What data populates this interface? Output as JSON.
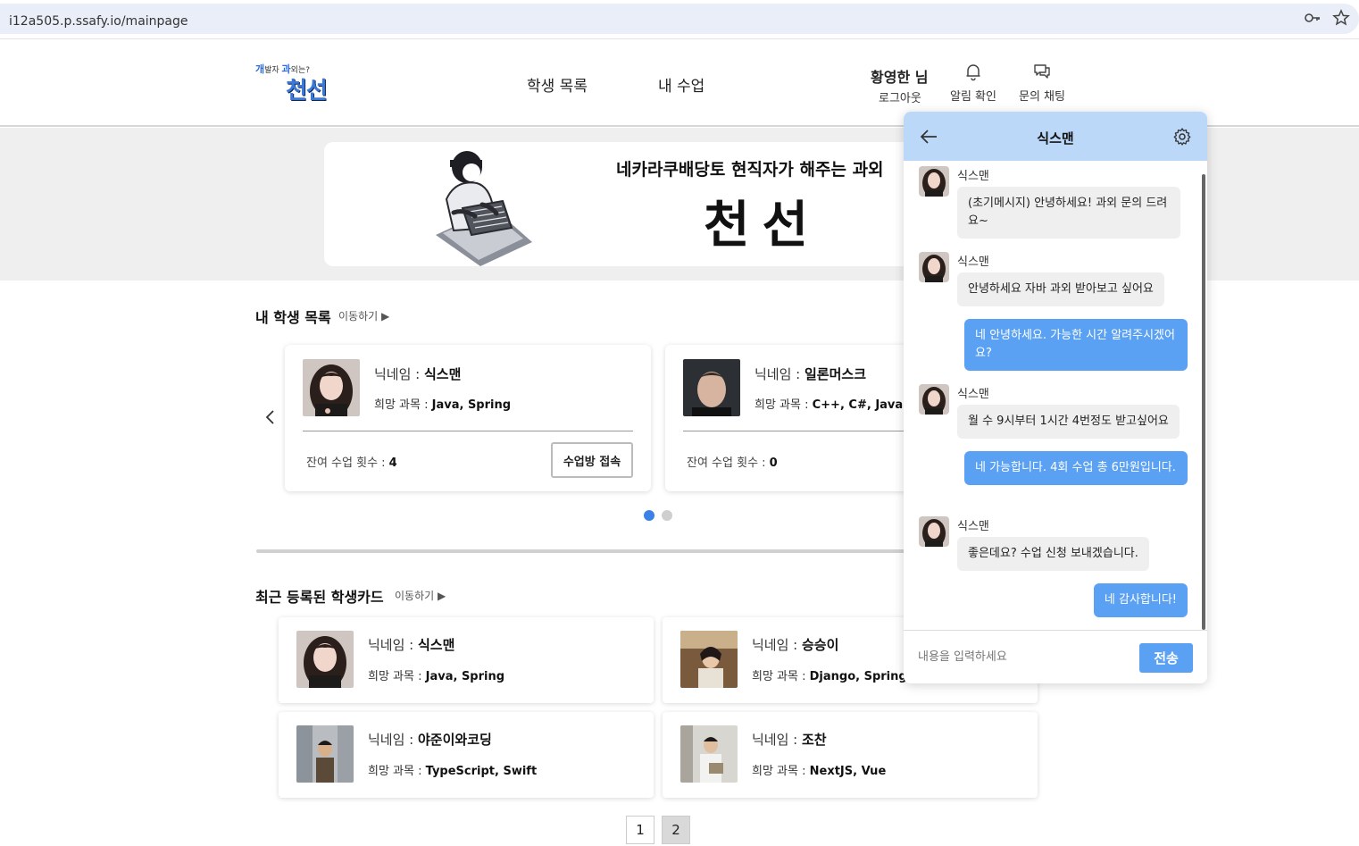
{
  "browser": {
    "url": "i12a505.p.ssafy.io/mainpage"
  },
  "header": {
    "logo_small_a": "개",
    "logo_small_b": "발자 ",
    "logo_small_c": "과",
    "logo_small_d": "외는?",
    "logo_main": "천선",
    "nav": [
      "학생 목록",
      "내 수업"
    ],
    "user_name": "황영한 님",
    "logout": "로그아웃",
    "notify_label": "알림 확인",
    "chat_label": "문의 채팅"
  },
  "banner": {
    "subtitle": "네카라쿠배당토 현직자가 해주는 과외",
    "title": "천선"
  },
  "my_students": {
    "title": "내 학생 목록",
    "link": "이동하기 ▶",
    "cards": [
      {
        "nick_label": "닉네임 : ",
        "nick": "식스맨",
        "subj_label": "희망 과목 : ",
        "subjects": "Java, Spring",
        "remain_label": "잔여 수업 횟수 : ",
        "remain": "4",
        "button": "수업방 접속"
      },
      {
        "nick_label": "닉네임 : ",
        "nick": "일론머스크",
        "subj_label": "희망 과목 : ",
        "subjects": "C++, C#, Java",
        "remain_label": "잔여 수업 횟수 : ",
        "remain": "0"
      }
    ]
  },
  "recent": {
    "title": "최근 등록된 학생카드",
    "link": "이동하기 ▶",
    "cards": [
      {
        "nick_label": "닉네임 : ",
        "nick": "식스맨",
        "subj_label": "희망 과목 : ",
        "subjects": "Java, Spring"
      },
      {
        "nick_label": "닉네임 : ",
        "nick": "승승이",
        "subj_label": "희망 과목 : ",
        "subjects": "Django, Spring"
      },
      {
        "nick_label": "닉네임 : ",
        "nick": "야준이와코딩",
        "subj_label": "희망 과목 : ",
        "subjects": "TypeScript, Swift"
      },
      {
        "nick_label": "닉네임 : ",
        "nick": "조찬",
        "subj_label": "희망 과목 : ",
        "subjects": "NextJS, Vue"
      }
    ]
  },
  "pagination": [
    "1",
    "2"
  ],
  "chat": {
    "title": "식스맨",
    "messages": [
      {
        "from": "them",
        "sender": "식스맨",
        "text": "(초기메시지) 안녕하세요! 과외 문의 드려요~"
      },
      {
        "from": "them",
        "sender": "식스맨",
        "text": "안녕하세요 자바 과외 받아보고 싶어요"
      },
      {
        "from": "me",
        "text": "네 안녕하세요. 가능한 시간 알려주시겠어요?"
      },
      {
        "from": "them",
        "sender": "식스맨",
        "text": "월 수 9시부터 1시간 4번정도 받고싶어요"
      },
      {
        "from": "me",
        "text": "네 가능합니다. 4회 수업 총 6만원입니다."
      },
      {
        "from": "them",
        "sender": "식스맨",
        "text": "좋은데요? 수업 신청 보내겠습니다."
      },
      {
        "from": "me",
        "text": "네 감사합니다!"
      }
    ],
    "input_placeholder": "내용을 입력하세요",
    "send_label": "전송"
  },
  "colors": {
    "accent": "#5ba1f3",
    "chat_header": "#bcd8f9",
    "dot_active": "#3b82e8",
    "dot_inactive": "#cfcfcf"
  },
  "icons": {
    "key": "key-icon",
    "star": "star-icon",
    "bell": "bell-icon",
    "chat": "chat-bubbles-icon",
    "back": "arrow-left-icon",
    "gear": "gear-icon",
    "prev": "chevron-left-icon"
  }
}
